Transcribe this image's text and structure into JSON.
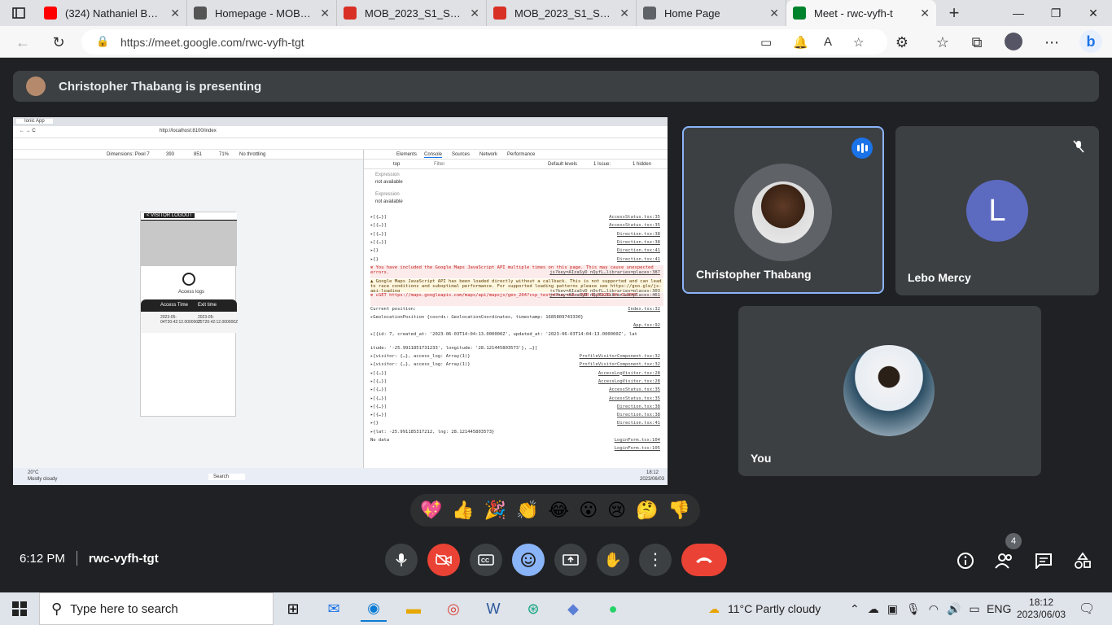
{
  "browser": {
    "tabs": [
      {
        "title": "(324) Nathaniel Bassey",
        "icon": "youtube-icon",
        "color": "#ff0000"
      },
      {
        "title": "Homepage - MOBILE",
        "icon": "d2l-icon",
        "color": "#555555"
      },
      {
        "title": "MOB_2023_S1_ST1_M",
        "icon": "pdf-icon",
        "color": "#d93025"
      },
      {
        "title": "MOB_2023_S1_ST2_M",
        "icon": "pdf-icon",
        "color": "#d93025"
      },
      {
        "title": "Home Page",
        "icon": "page-icon",
        "color": "#5f6368"
      },
      {
        "title": "Meet - rwc-vyfh-t",
        "icon": "meet-icon",
        "color": "#00832d"
      }
    ],
    "url": "https://meet.google.com/rwc-vyfh-tgt"
  },
  "meet": {
    "presenting_banner": "Christopher Thabang is presenting",
    "participants": [
      {
        "name": "Christopher Thabang",
        "speaking": true
      },
      {
        "name": "Lebo Mercy",
        "initial": "L",
        "avatar_color": "#5c6bc0",
        "muted": true
      },
      {
        "name": "You"
      }
    ],
    "time": "6:12 PM",
    "meeting_code": "rwc-vyfh-tgt",
    "people_count": "4",
    "reactions": [
      "💖",
      "👍",
      "🎉",
      "👏",
      "😂",
      "😮",
      "😢",
      "🤔",
      "👎"
    ]
  },
  "shared_screen": {
    "address": "http://localhost:8100/index",
    "dimensions_label": "Dimensions: Pixel 7",
    "width": "393",
    "height": "851",
    "zoom": "71%",
    "throttle": "No throttling",
    "devtools_tabs": [
      "Elements",
      "Console",
      "Sources",
      "Network",
      "Performance"
    ],
    "filter_placeholder": "Filter",
    "top_label": "top",
    "default_levels": "Default levels",
    "issues": "1 Issue:",
    "hidden": "1 hidden",
    "expressions": [
      {
        "label": "Expression",
        "value": "not available"
      },
      {
        "label": "Expression",
        "value": "not available"
      }
    ],
    "logs": [
      {
        "text": "▸[{…}]",
        "src": "AccessStatus.tsx:35",
        "type": "normal"
      },
      {
        "text": "▸[{…}]",
        "src": "AccessStatus.tsx:35",
        "type": "normal"
      },
      {
        "text": "▸[{…}]",
        "src": "Direction.tsx:38",
        "type": "normal"
      },
      {
        "text": "▸[{…}]",
        "src": "Direction.tsx:38",
        "type": "normal"
      },
      {
        "text": "▸{}",
        "src": "Direction.tsx:41",
        "type": "normal"
      },
      {
        "text": "▸{}",
        "src": "Direction.tsx:41",
        "type": "normal"
      },
      {
        "text": "⊗ You have included the Google Maps JavaScript API multiple times on this page. This may cause unexpected errors.",
        "src": "js?key=AIzaSyD_nQyfL…libraries=places:387",
        "type": "err"
      },
      {
        "text": "▲ Google Maps JavaScript API has been loaded directly without a callback. This is not supported and can lead to race conditions and suboptimal performance. For supported loading patterns please see https://goo.gle/js-api-loading",
        "src": "js?key=AIzaSyD_nQyfL…libraries=places:303",
        "type": "warn"
      },
      {
        "text": "⊗ ▸GET https://maps.googleapis.com/maps/api/mapsjs/gen_204?csp_test=true net::ERR_BLOCKED_BY_CLIENT",
        "src": "js?key=AIzaSyD_nQyfL…libraries=places:461",
        "type": "err"
      },
      {
        "text": "Current position:",
        "src": "Index.tsx:32",
        "type": "normal"
      },
      {
        "text": "▸GeolocationPosition {coords: GeolocationCoordinates, timestamp: 1685809743330}",
        "src": "",
        "type": "normal"
      },
      {
        "text": "",
        "src": "App.tsx:92",
        "type": "normal"
      },
      {
        "text": "▸[{id: 7, created_at: '2023-06-03T14:04:13.000000Z', updated_at: '2023-06-03T14:04:13.000000Z', lat",
        "src": "",
        "type": "normal"
      },
      {
        "text": "itude: '-25.9911851731233', longitude: '28.121445803573'}, …}]",
        "src": "",
        "type": "normal"
      },
      {
        "text": "▸{visitor: {…}, access_log: Array(1)}",
        "src": "ProfileVisitorComponent.tsx:32",
        "type": "normal"
      },
      {
        "text": "▸{visitor: {…}, access_log: Array(1)}",
        "src": "ProfileVisitorComponent.tsx:32",
        "type": "normal"
      },
      {
        "text": "▸[{…}]",
        "src": "AccessLogVisitor.tsx:28",
        "type": "normal"
      },
      {
        "text": "▸[{…}]",
        "src": "AccessLogVisitor.tsx:28",
        "type": "normal"
      },
      {
        "text": "▸[{…}]",
        "src": "AccessStatus.tsx:35",
        "type": "normal"
      },
      {
        "text": "▸[{…}]",
        "src": "AccessStatus.tsx:35",
        "type": "normal"
      },
      {
        "text": "▸[{…}]",
        "src": "Direction.tsx:38",
        "type": "normal"
      },
      {
        "text": "▸[{…}]",
        "src": "Direction.tsx:38",
        "type": "normal"
      },
      {
        "text": "▸{}",
        "src": "Direction.tsx:41",
        "type": "normal"
      },
      {
        "text": "▸{lat: -25.991185317212, lng: 28.121445803573}",
        "src": "",
        "type": "normal"
      },
      {
        "text": "No data",
        "src": "LoginForm.tsx:104",
        "type": "normal"
      },
      {
        "text": "",
        "src": "LoginForm.tsx:105",
        "type": "normal"
      }
    ],
    "phone": {
      "header_button": "< VISITOR LOGOUT",
      "access_logs": "Access logs",
      "col_access": "Access Time",
      "col_exit": "Exit time",
      "row_access": "2023-05-04T20:42:12.000000Z",
      "row_exit": "2023-05-25T20:42:12.000000Z"
    },
    "taskbar_weather": "20°C",
    "taskbar_weather_desc": "Mostly cloudy",
    "taskbar_search": "Search",
    "taskbar_time": "18:12",
    "taskbar_date": "2023/06/03"
  },
  "taskbar": {
    "search_placeholder": "Type here to search",
    "weather": "11°C  Partly cloudy",
    "language": "ENG",
    "time": "18:12",
    "date": "2023/06/03"
  }
}
